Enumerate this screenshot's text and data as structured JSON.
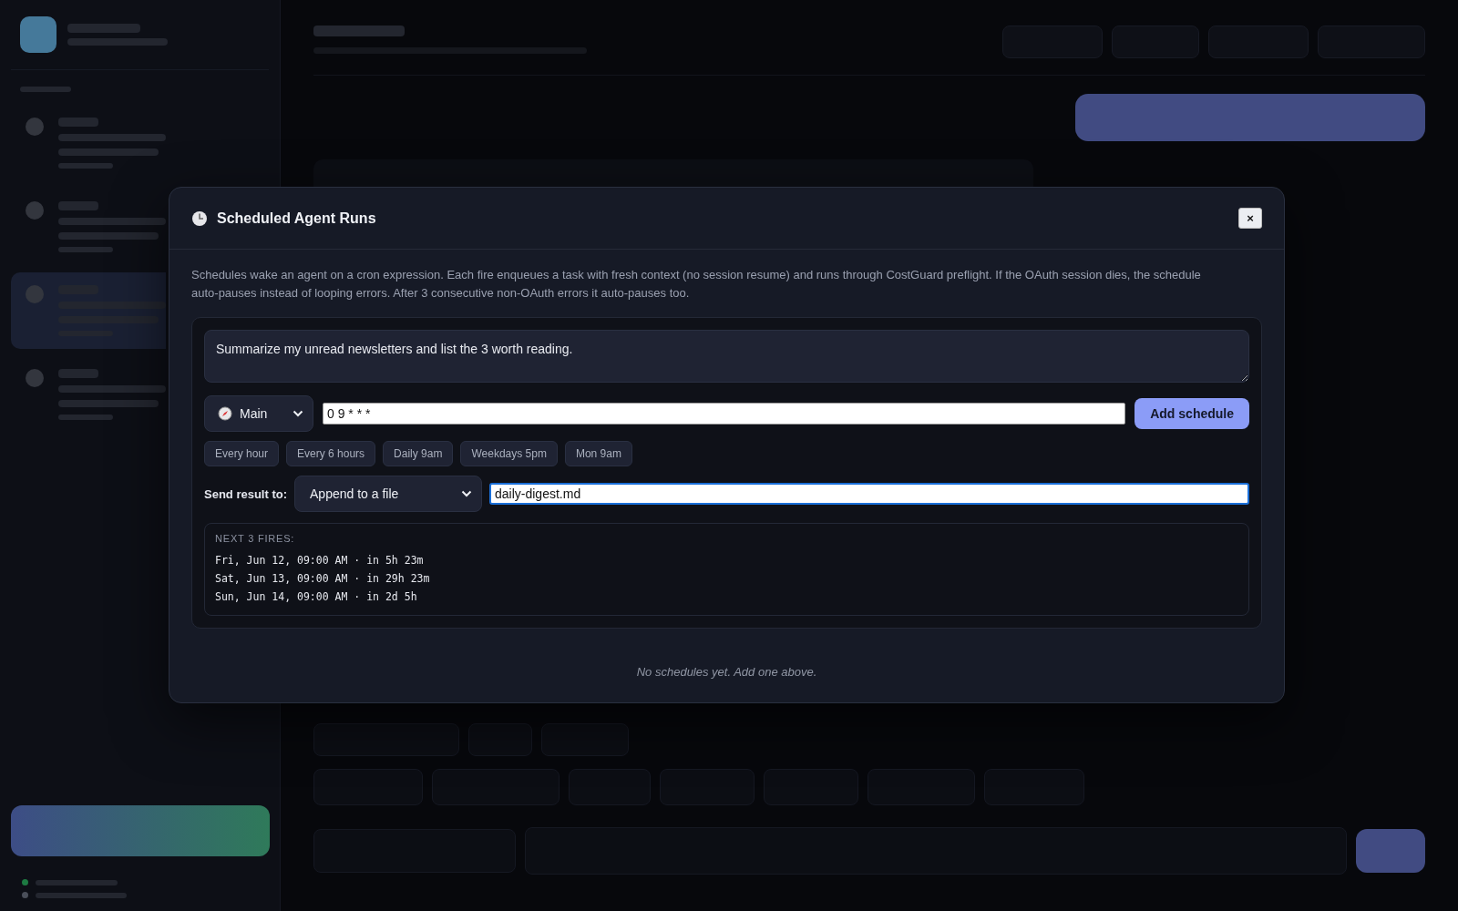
{
  "sidebar": {
    "agents": [
      {
        "selected": false
      },
      {
        "selected": false
      },
      {
        "selected": true
      },
      {
        "selected": false
      }
    ],
    "status": [
      {
        "color": "#1d7a42"
      },
      {
        "color": "#4a4f5a"
      }
    ]
  },
  "modal": {
    "title": "Scheduled Agent Runs",
    "close": "×",
    "description": "Schedules wake an agent on a cron expression. Each fire enqueues a task with fresh context (no session resume) and runs through CostGuard preflight. If the OAuth session dies, the schedule auto-pauses instead of looping errors. After 3 consecutive non-OAuth errors it auto-pauses too.",
    "prompt": "Summarize my unread newsletters and list the 3 worth reading.",
    "agent": "Main",
    "cron": "0 9 * * *",
    "add_button": "Add schedule",
    "presets": [
      "Every hour",
      "Every 6 hours",
      "Daily 9am",
      "Weekdays 5pm",
      "Mon 9am"
    ],
    "destination_label": "Send result to:",
    "destination": "Append to a file",
    "file": {
      "value": "daily-digest.md",
      "focused": true
    },
    "next_fires_label": "NEXT 3 FIRES:",
    "next_fires": [
      "Fri, Jun 12, 09:00 AM · in 5h 23m",
      "Sat, Jun 13, 09:00 AM · in 29h 23m",
      "Sun, Jun 14, 09:00 AM · in 2d 5h"
    ],
    "empty": "No schedules yet. Add one above."
  }
}
